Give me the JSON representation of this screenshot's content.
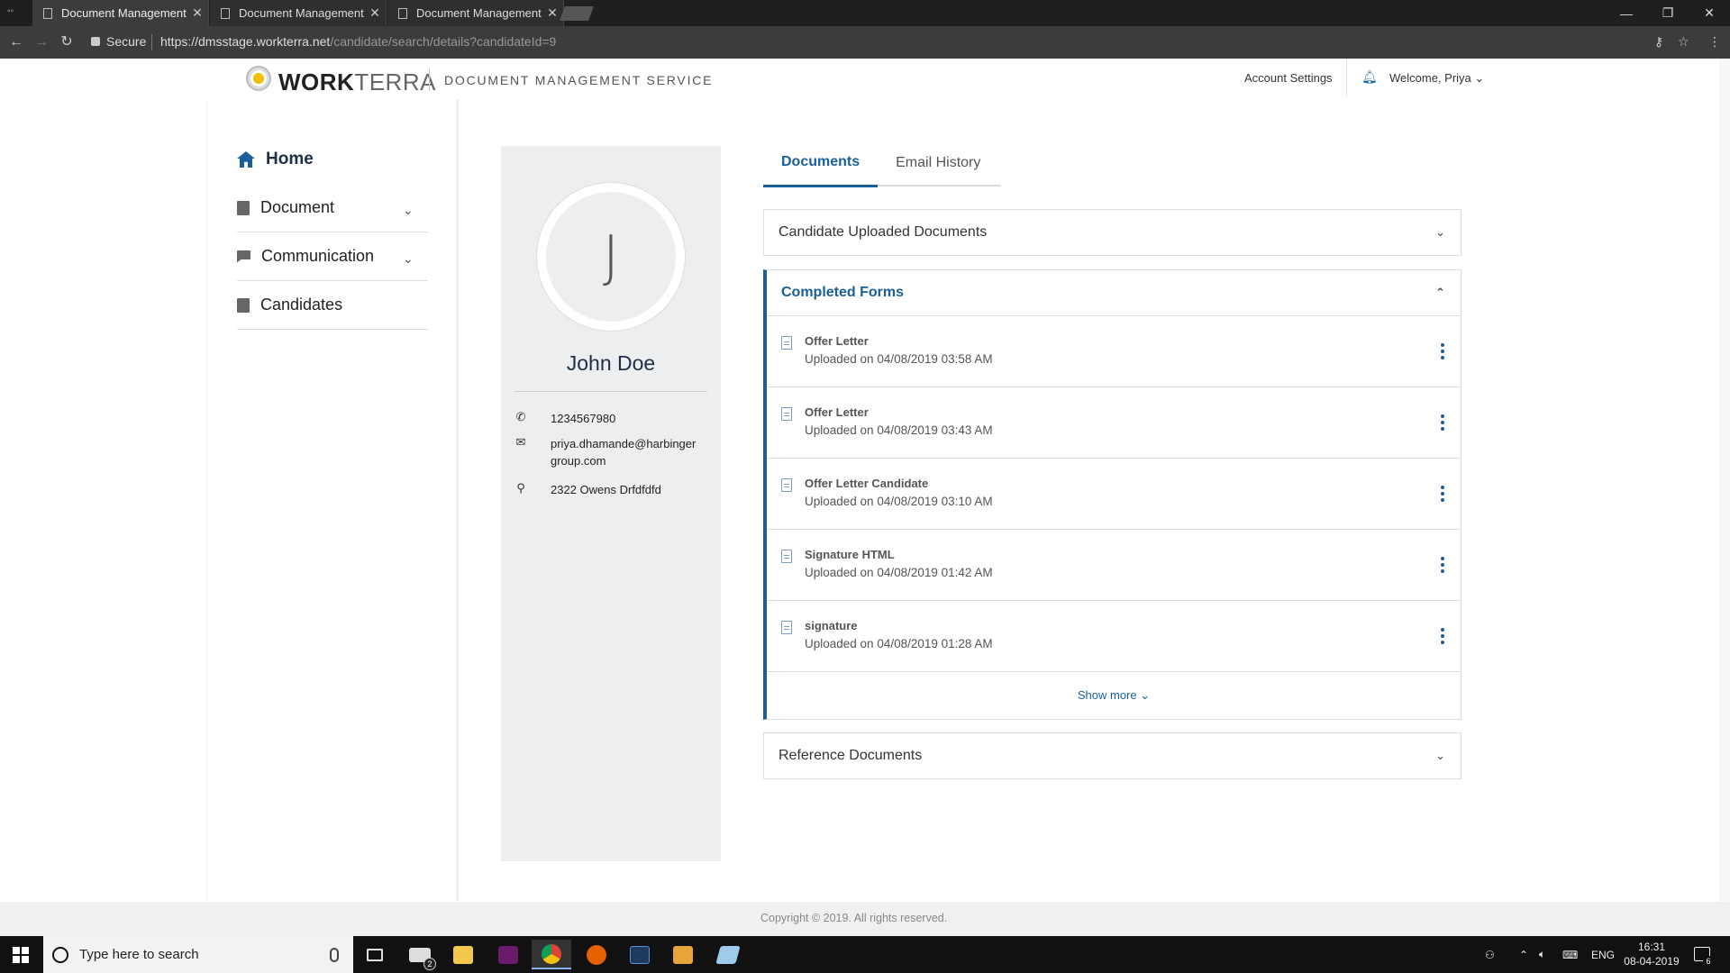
{
  "browser": {
    "tabs": [
      {
        "label": "Document Management"
      },
      {
        "label": "Document Management"
      },
      {
        "label": "Document Management"
      }
    ],
    "secure_label": "Secure",
    "url_host": "https://dmsstage.workterra.net",
    "url_path": "/candidate/search/details?candidateId=9"
  },
  "header": {
    "logo_bold": "WORK",
    "logo_light": "TERRA",
    "service_name": "DOCUMENT MANAGEMENT SERVICE",
    "account_settings": "Account Settings",
    "welcome": "Welcome, Priya"
  },
  "sidebar": {
    "items": [
      {
        "label": "Home",
        "icon": "home-icon"
      },
      {
        "label": "Document",
        "icon": "document-icon"
      },
      {
        "label": "Communication",
        "icon": "chat-icon"
      },
      {
        "label": "Candidates",
        "icon": "id-badge-icon"
      }
    ]
  },
  "profile": {
    "initial": "J",
    "name": "John Doe",
    "phone": "1234567980",
    "email": "priya.dhamande@harbingergroup.com",
    "address": "2322 Owens Drfdfdfd"
  },
  "tabs": [
    {
      "label": "Documents",
      "active": true
    },
    {
      "label": "Email History",
      "active": false
    }
  ],
  "sections": {
    "candidate_uploaded": "Candidate Uploaded Documents",
    "completed_forms": "Completed Forms",
    "reference_documents": "Reference Documents",
    "show_more": "Show more"
  },
  "completed_forms": [
    {
      "name": "Offer Letter",
      "date": "Uploaded on 04/08/2019 03:58 AM"
    },
    {
      "name": "Offer Letter",
      "date": "Uploaded on 04/08/2019 03:43 AM"
    },
    {
      "name": "Offer Letter Candidate",
      "date": "Uploaded on 04/08/2019 03:10 AM"
    },
    {
      "name": "Signature HTML",
      "date": "Uploaded on 04/08/2019 01:42 AM"
    },
    {
      "name": "signature",
      "date": "Uploaded on 04/08/2019 01:28 AM"
    }
  ],
  "footer": {
    "copyright": "Copyright © 2019. All rights reserved."
  },
  "taskbar": {
    "search_placeholder": "Type here to search",
    "mail_badge": "2",
    "language": "ENG",
    "time": "16:31",
    "date": "08-04-2019",
    "notification_count": "6"
  },
  "colors": {
    "accent": "#1a5f99",
    "profile_bg": "#eceef0"
  }
}
